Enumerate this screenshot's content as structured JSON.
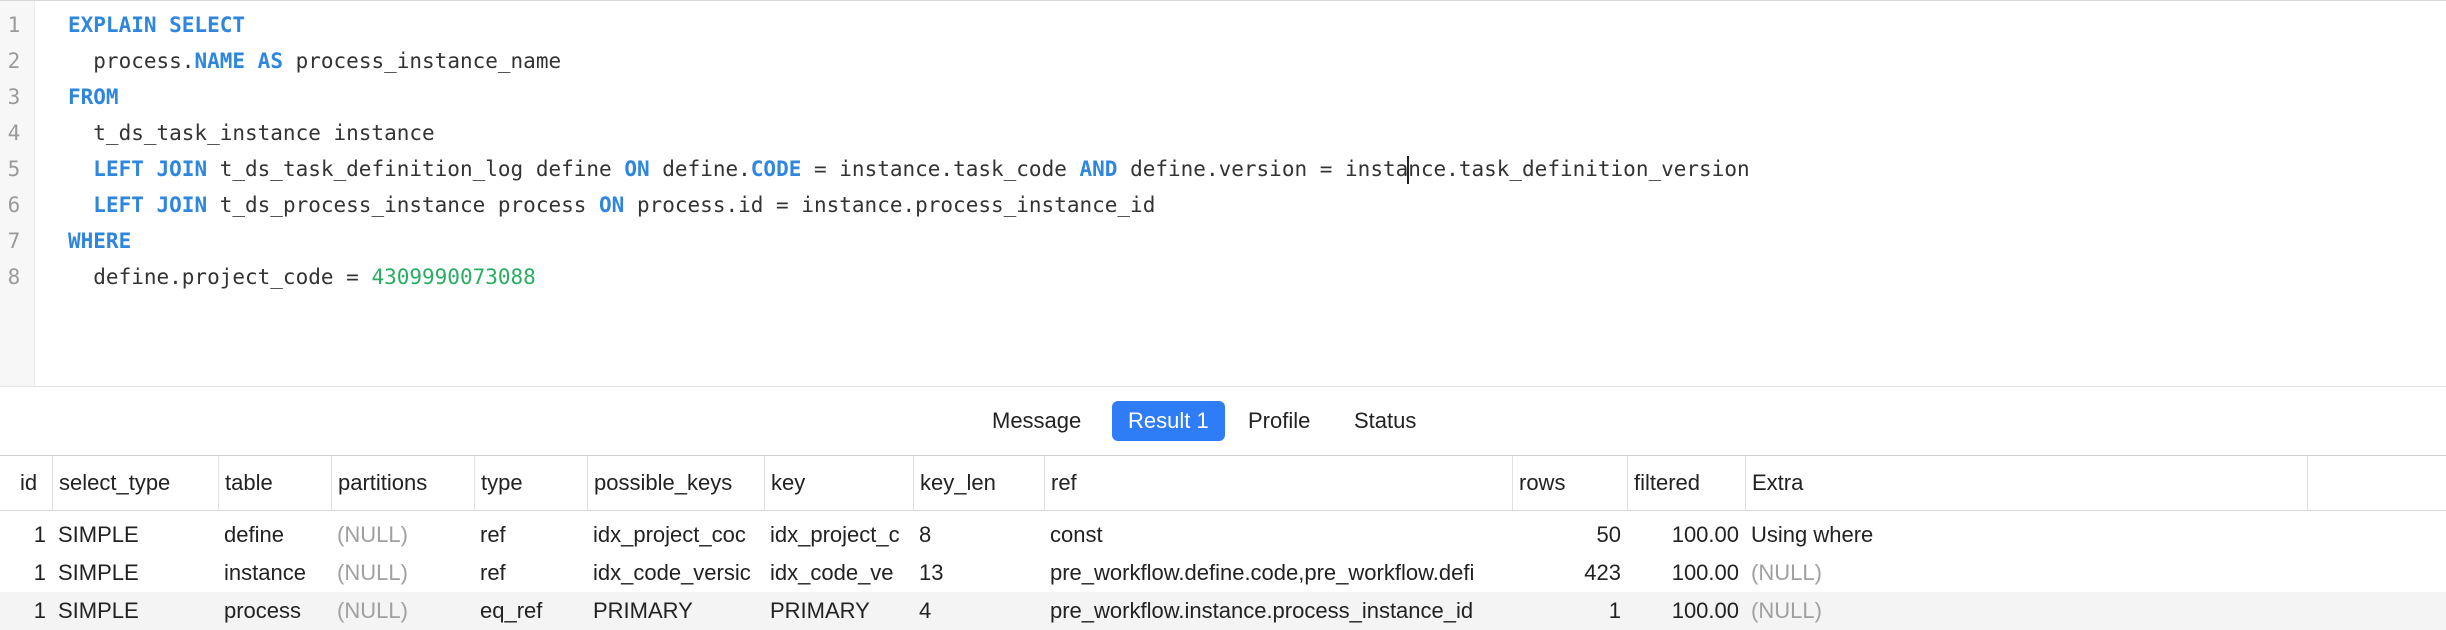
{
  "editor": {
    "line_numbers": [
      "1",
      "2",
      "3",
      "4",
      "5",
      "6",
      "7",
      "8"
    ],
    "lines": [
      {
        "parts": [
          {
            "t": "EXPLAIN SELECT",
            "c": "kw"
          }
        ]
      },
      {
        "parts": [
          {
            "t": "  process.",
            "c": ""
          },
          {
            "t": "NAME",
            "c": "kw"
          },
          {
            "t": " ",
            "c": ""
          },
          {
            "t": "AS",
            "c": "kw"
          },
          {
            "t": " process_instance_name",
            "c": ""
          }
        ]
      },
      {
        "parts": [
          {
            "t": "FROM",
            "c": "kw"
          }
        ]
      },
      {
        "parts": [
          {
            "t": "  t_ds_task_instance instance",
            "c": ""
          }
        ]
      },
      {
        "parts": [
          {
            "t": "  ",
            "c": ""
          },
          {
            "t": "LEFT JOIN",
            "c": "kw"
          },
          {
            "t": " t_ds_task_definition_log define ",
            "c": ""
          },
          {
            "t": "ON",
            "c": "kw"
          },
          {
            "t": " define.",
            "c": ""
          },
          {
            "t": "CODE",
            "c": "kw"
          },
          {
            "t": " = instance.task_code ",
            "c": ""
          },
          {
            "t": "AND",
            "c": "kw"
          },
          {
            "t": " define.version = insta",
            "c": ""
          },
          {
            "t": "|",
            "c": "caret"
          },
          {
            "t": "nce.task_definition_version",
            "c": ""
          }
        ]
      },
      {
        "parts": [
          {
            "t": "  ",
            "c": ""
          },
          {
            "t": "LEFT JOIN",
            "c": "kw"
          },
          {
            "t": " t_ds_process_instance process ",
            "c": ""
          },
          {
            "t": "ON",
            "c": "kw"
          },
          {
            "t": " process.id = instance.process_instance_id",
            "c": ""
          }
        ]
      },
      {
        "parts": [
          {
            "t": "WHERE",
            "c": "kw"
          }
        ]
      },
      {
        "parts": [
          {
            "t": "  define.project_code = ",
            "c": ""
          },
          {
            "t": "4309990073088",
            "c": "num"
          }
        ]
      }
    ]
  },
  "tabs": [
    {
      "label": "Message",
      "active": false
    },
    {
      "label": "Result 1",
      "active": true
    },
    {
      "label": "Profile",
      "active": false
    },
    {
      "label": "Status",
      "active": false
    }
  ],
  "results": {
    "columns": [
      "id",
      "select_type",
      "table",
      "partitions",
      "type",
      "possible_keys",
      "key",
      "key_len",
      "ref",
      "rows",
      "filtered",
      "Extra"
    ],
    "rows": [
      [
        "1",
        "SIMPLE",
        "define",
        "(NULL)",
        "ref",
        "idx_project_coc",
        "idx_project_c",
        "8",
        "const",
        "50",
        "100.00",
        "Using where"
      ],
      [
        "1",
        "SIMPLE",
        "instance",
        "(NULL)",
        "ref",
        "idx_code_versic",
        "idx_code_ve",
        "13",
        "pre_workflow.define.code,pre_workflow.defi",
        "423",
        "100.00",
        "(NULL)"
      ],
      [
        "1",
        "SIMPLE",
        "process",
        "(NULL)",
        "eq_ref",
        "PRIMARY",
        "PRIMARY",
        "4",
        "pre_workflow.instance.process_instance_id",
        "1",
        "100.00",
        "(NULL)"
      ]
    ]
  },
  "colors": {
    "keyword": "#2e86de",
    "number": "#27ae60",
    "active_tab": "#2f7df6",
    "null_text": "#a0a0a0"
  }
}
